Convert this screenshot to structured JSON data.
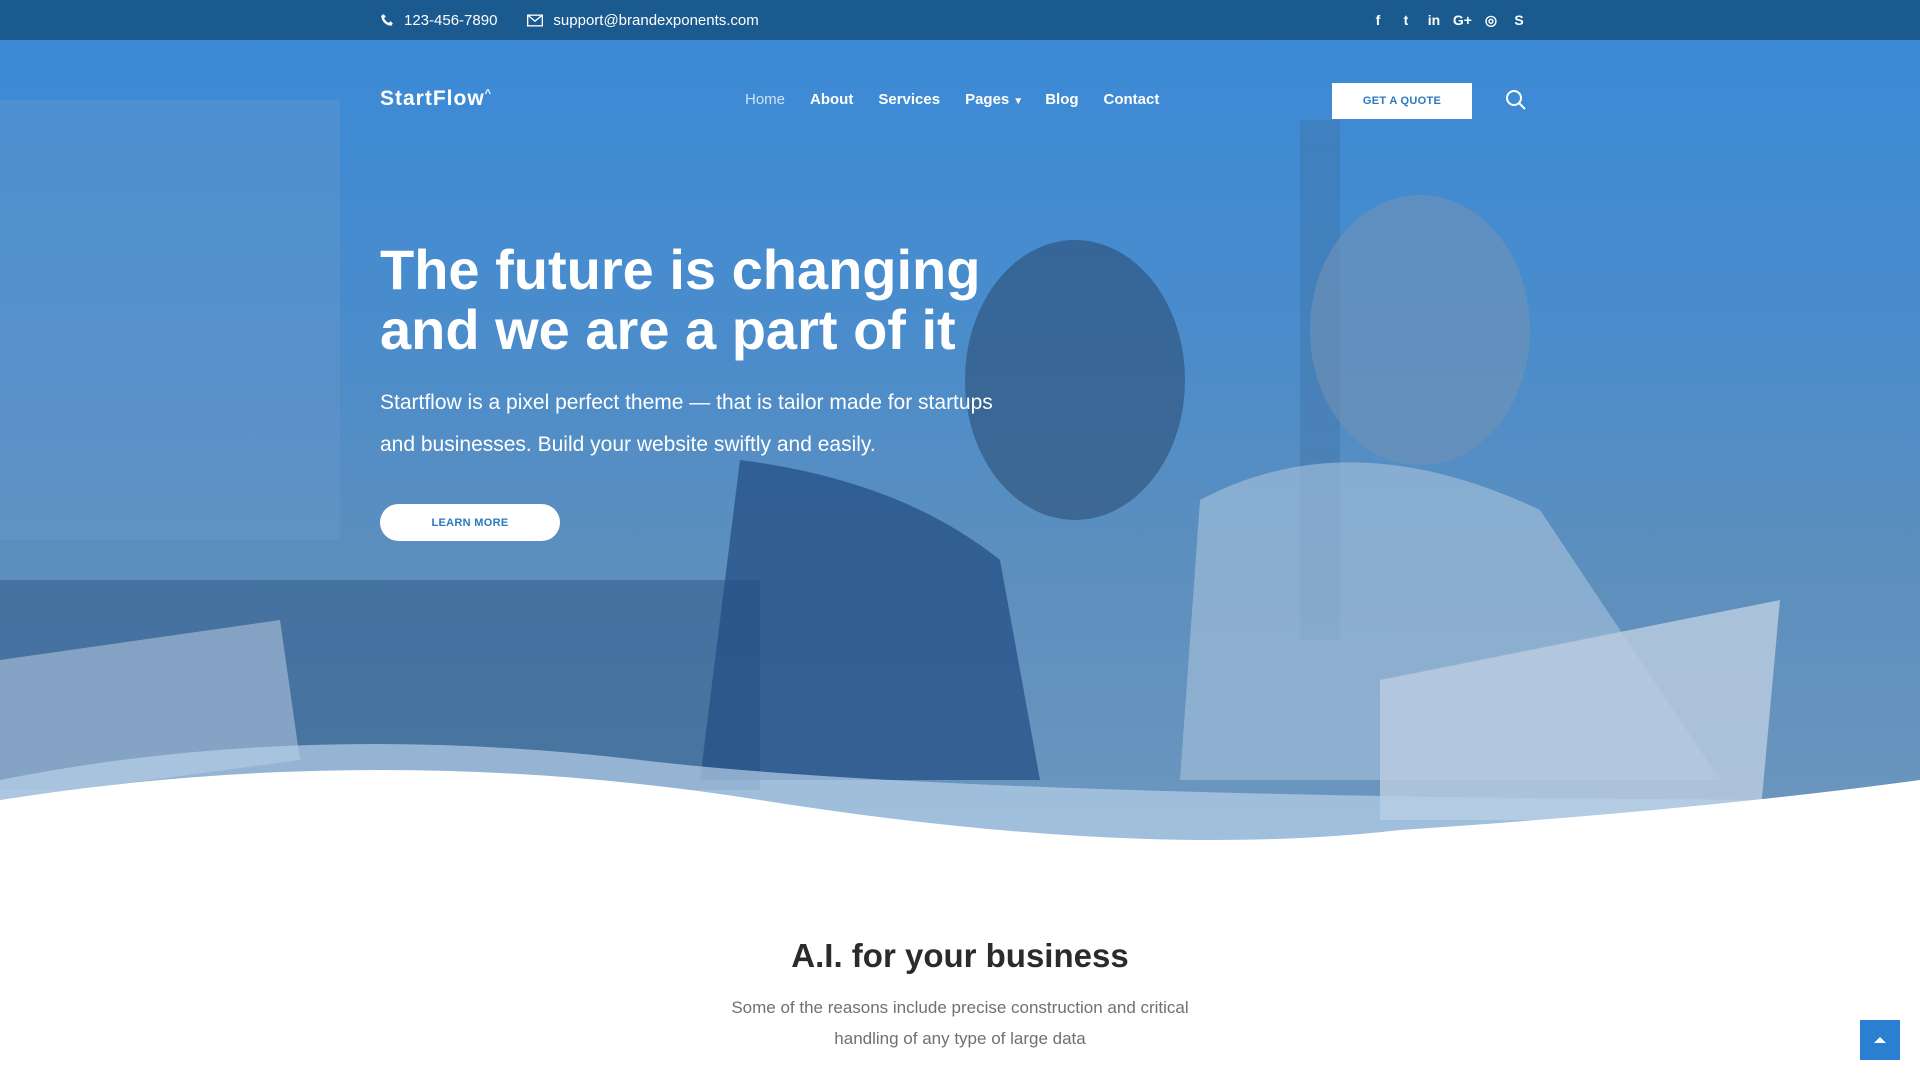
{
  "topbar": {
    "phone": "123-456-7890",
    "email": "support@brandexponents.com",
    "socials": [
      {
        "name": "facebook-icon",
        "glyph": "f"
      },
      {
        "name": "twitter-icon",
        "glyph": "t"
      },
      {
        "name": "linkedin-icon",
        "glyph": "in"
      },
      {
        "name": "google-plus-icon",
        "glyph": "G+"
      },
      {
        "name": "instagram-icon",
        "glyph": "◎"
      },
      {
        "name": "skype-icon",
        "glyph": "S"
      }
    ]
  },
  "nav": {
    "logo": "StartFlow",
    "logo_mark": "^",
    "items": [
      "Home",
      "About",
      "Services",
      "Pages",
      "Blog",
      "Contact"
    ],
    "quote_label": "GET A QUOTE"
  },
  "hero": {
    "title_line1": "The future is changing",
    "title_line2": "and we are a part of it",
    "text": "Startflow is a pixel perfect theme — that is tailor made for startups and businesses. Build your website swiftly and easily.",
    "button": "LEARN MORE"
  },
  "section": {
    "title": "A.I. for your business",
    "text": "Some of the reasons include precise construction and critical handling of any type of large data"
  },
  "colors": {
    "topbar": "#1a5a8e",
    "accent": "#2a78c2",
    "hero": "#3b8ad6"
  }
}
